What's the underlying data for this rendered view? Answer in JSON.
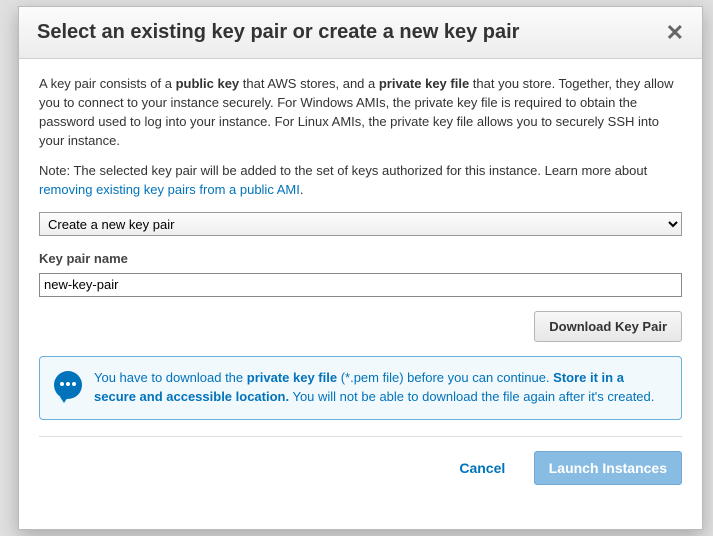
{
  "modal": {
    "title": "Select an existing key pair or create a new key pair",
    "description": {
      "pre1": "A key pair consists of a ",
      "b1": "public key",
      "mid1": " that AWS stores, and a ",
      "b2": "private key file",
      "post1": " that you store. Together, they allow you to connect to your instance securely. For Windows AMIs, the private key file is required to obtain the password used to log into your instance. For Linux AMIs, the private key file allows you to securely SSH into your instance."
    },
    "note": {
      "text": "Note: The selected key pair will be added to the set of keys authorized for this instance. Learn more about ",
      "link": "removing existing key pairs from a public AMI",
      "suffix": "."
    },
    "select": {
      "selected": "Create a new key pair"
    },
    "keypair": {
      "label": "Key pair name",
      "value": "new-key-pair"
    },
    "download_button": "Download Key Pair",
    "info": {
      "p1a": "You have to download the ",
      "p1b": "private key file",
      "p1c": " (*.pem file) before you can continue. ",
      "p2a": "Store it in a secure and accessible location.",
      "p2b": " You will not be able to download the file again after it's created."
    },
    "footer": {
      "cancel": "Cancel",
      "launch": "Launch Instances"
    }
  }
}
